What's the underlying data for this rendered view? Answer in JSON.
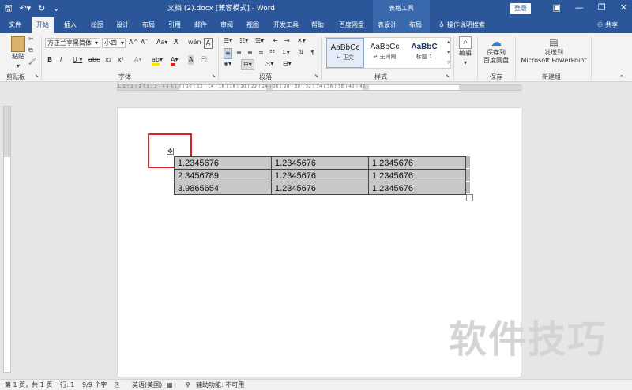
{
  "titlebar": {
    "doc_title": "文档 (2).docx [兼容模式]  -  Word",
    "context_title": "表格工具",
    "login": "登录"
  },
  "tabs": [
    {
      "label": "文件"
    },
    {
      "label": "开始"
    },
    {
      "label": "插入"
    },
    {
      "label": "绘图"
    },
    {
      "label": "设计"
    },
    {
      "label": "布局"
    },
    {
      "label": "引用"
    },
    {
      "label": "邮件"
    },
    {
      "label": "审阅"
    },
    {
      "label": "视图"
    },
    {
      "label": "开发工具"
    },
    {
      "label": "帮助"
    },
    {
      "label": "百度网盘"
    },
    {
      "label": "表设计"
    },
    {
      "label": "布局"
    }
  ],
  "tell_me": "操作说明搜索",
  "share": "共享",
  "ribbon": {
    "clipboard": {
      "paste": "粘贴",
      "group": "剪贴板"
    },
    "font": {
      "name": "方正兰亭黑简体",
      "size": "小四",
      "group": "字体"
    },
    "paragraph": {
      "group": "段落"
    },
    "styles": {
      "items": [
        {
          "preview": "AaBbCc",
          "name": "↵ 正文"
        },
        {
          "preview": "AaBbCc",
          "name": "↵ 无间隔"
        },
        {
          "preview": "AaBbC",
          "name": "标题 1"
        }
      ],
      "group": "样式"
    },
    "editing": {
      "label": "编辑"
    },
    "save": {
      "line1": "保存到",
      "line2": "百度网盘",
      "group": "保存"
    },
    "send": {
      "line1": "发送到",
      "line2": "Microsoft PowerPoint",
      "group": "新建组"
    }
  },
  "ruler_ticks": "L 2 | 1 | 2 | 1 | 2 | 4 | 6 | 8 | 10 | 12 | 14 | 16 | 18 | 20 | 22 | 24 | 26 | 28 | 30 | 32 | 34 | 36 | 38 | 40 | 42",
  "table": {
    "rows": [
      [
        "1.2345676",
        "1.2345676",
        "1.2345676"
      ],
      [
        "2.3456789",
        "1.2345676",
        "1.2345676"
      ],
      [
        "3.9865654",
        "1.2345676",
        "1.2345676"
      ]
    ]
  },
  "watermark": "软件技巧",
  "status": {
    "page": "第 1 页，共 1 页",
    "line": "行: 1",
    "chars": "9/9 个字",
    "language": "英语(美国)",
    "accessibility": "辅助功能: 不可用"
  },
  "colors": {
    "titlebar": "#2b579a",
    "highlight": "#e02020",
    "table_fill": "#c8c8c8"
  }
}
